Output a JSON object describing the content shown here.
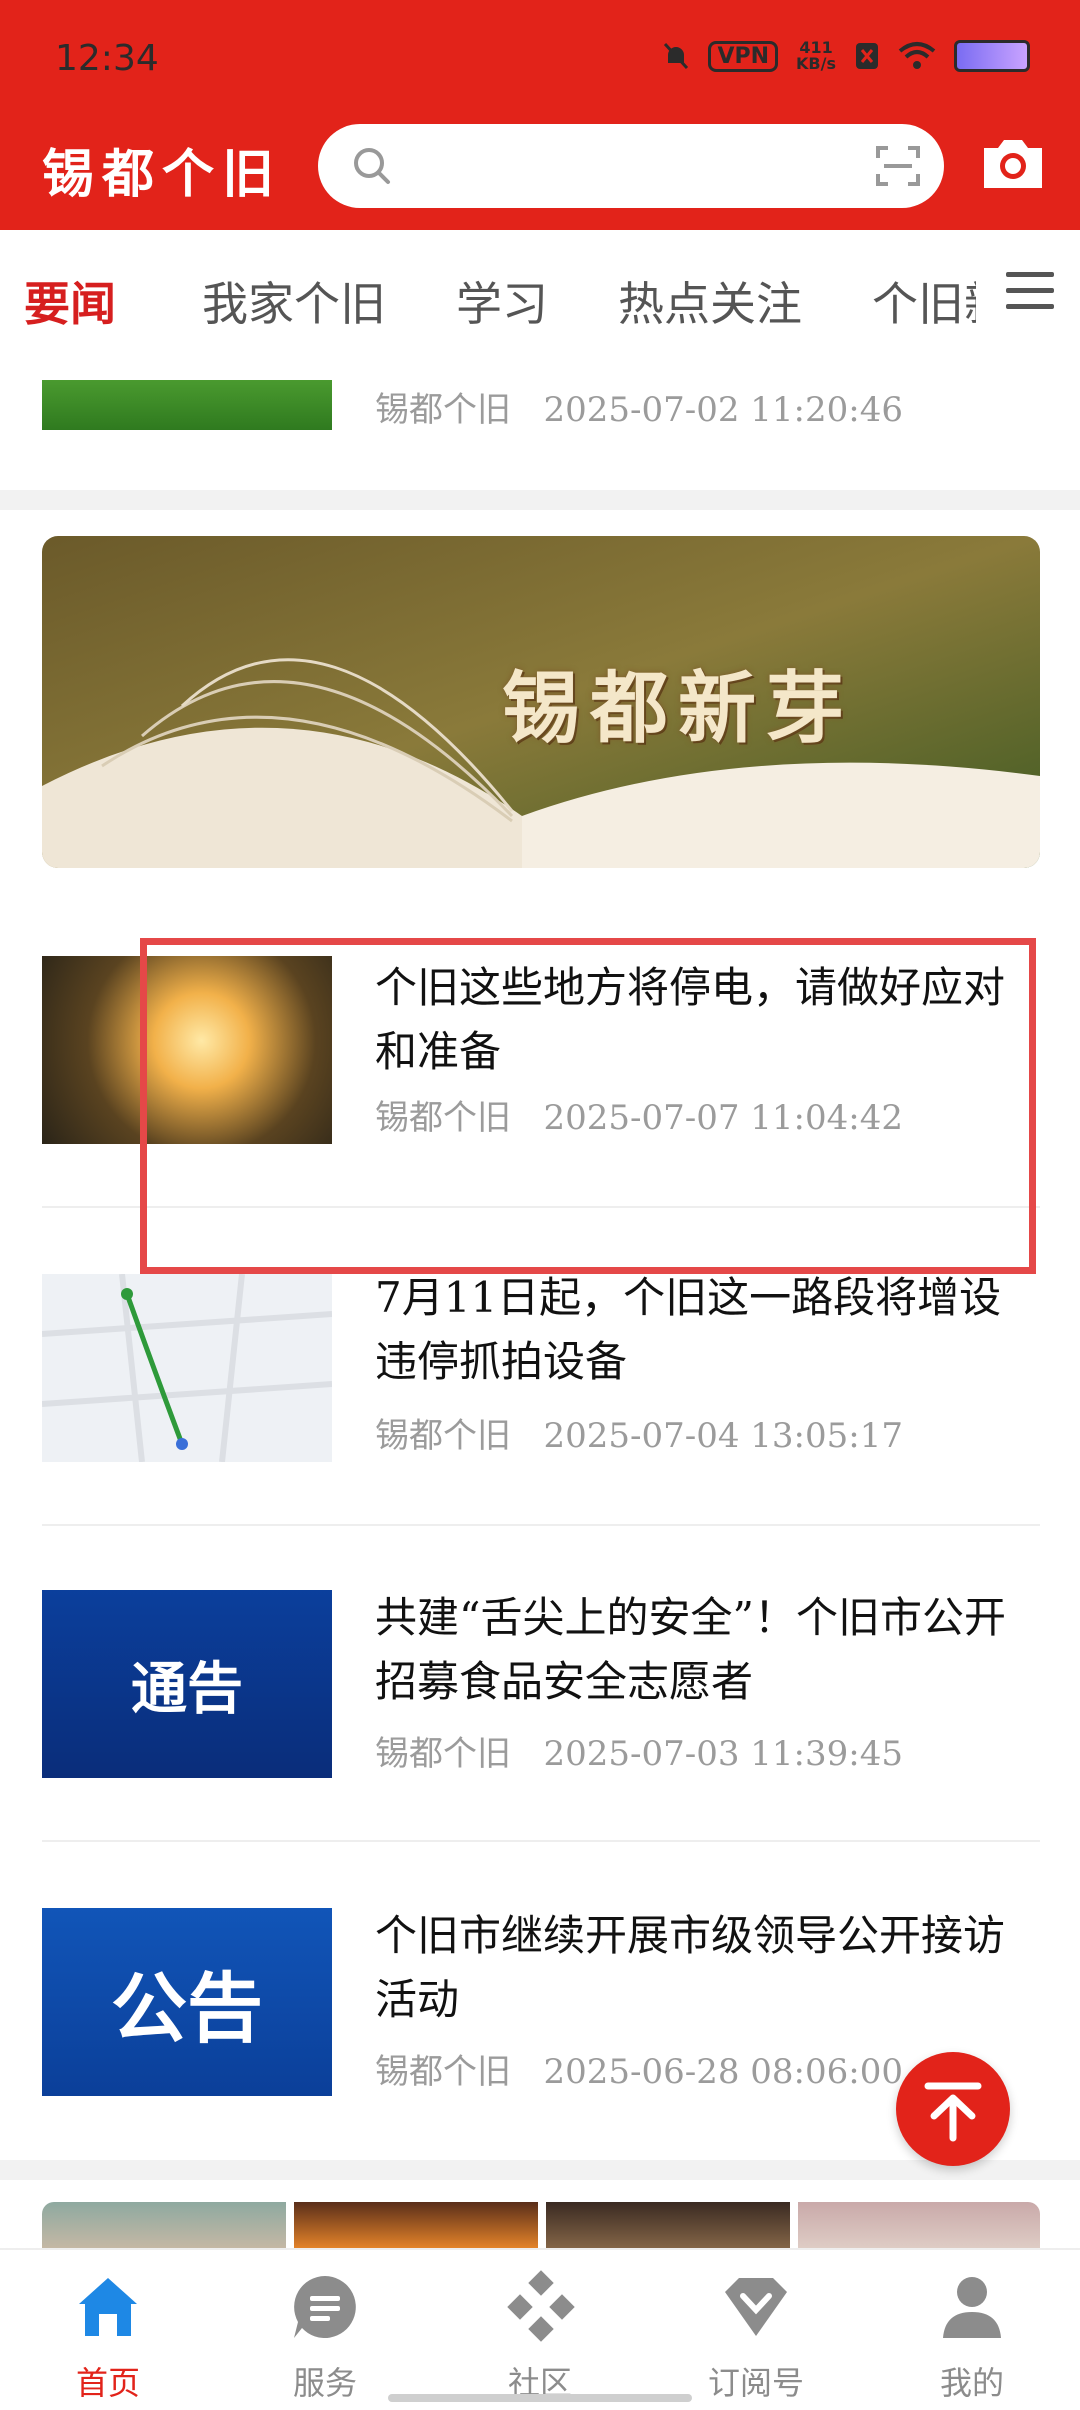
{
  "status_bar": {
    "time": "12:34",
    "vpn": "VPN",
    "speed_value": "411",
    "speed_unit": "KB/s"
  },
  "app": {
    "logo": "锡都个旧",
    "search_placeholder": ""
  },
  "tabs": [
    {
      "label": "要闻",
      "active": true
    },
    {
      "label": "我家个旧",
      "active": false
    },
    {
      "label": "学习",
      "active": false
    },
    {
      "label": "热点关注",
      "active": false
    },
    {
      "label": "个旧新",
      "active": false
    }
  ],
  "feed": {
    "partial_article": {
      "source": "锡都个旧",
      "date": "2025-07-02 11:20:46"
    },
    "banner": {
      "text": "锡都新芽"
    },
    "articles": [
      {
        "title": "个旧这些地方将停电，请做好应对和准备",
        "source": "锡都个旧",
        "date": "2025-07-07 11:04:42"
      },
      {
        "title": "7月11日起，个旧这一路段将增设违停抓拍设备",
        "source": "锡都个旧",
        "date": "2025-07-04 13:05:17"
      },
      {
        "title": "共建“舌尖上的安全”！个旧市公开招募食品安全志愿者",
        "source": "锡都个旧",
        "date": "2025-07-03 11:39:45",
        "thumb_text": "通告"
      },
      {
        "title": "个旧市继续开展市级领导公开接访活动",
        "source": "锡都个旧",
        "date": "2025-06-28 08:06:00",
        "thumb_text": "公告"
      }
    ]
  },
  "bottom_nav": [
    {
      "label": "首页",
      "icon": "home-icon",
      "active": true
    },
    {
      "label": "服务",
      "icon": "service-icon",
      "active": false
    },
    {
      "label": "社区",
      "icon": "community-icon",
      "active": false
    },
    {
      "label": "订阅号",
      "icon": "subscription-icon",
      "active": false
    },
    {
      "label": "我的",
      "icon": "profile-icon",
      "active": false
    }
  ],
  "colors": {
    "brand_red": "#e2231a",
    "highlight_red": "#e54848"
  }
}
